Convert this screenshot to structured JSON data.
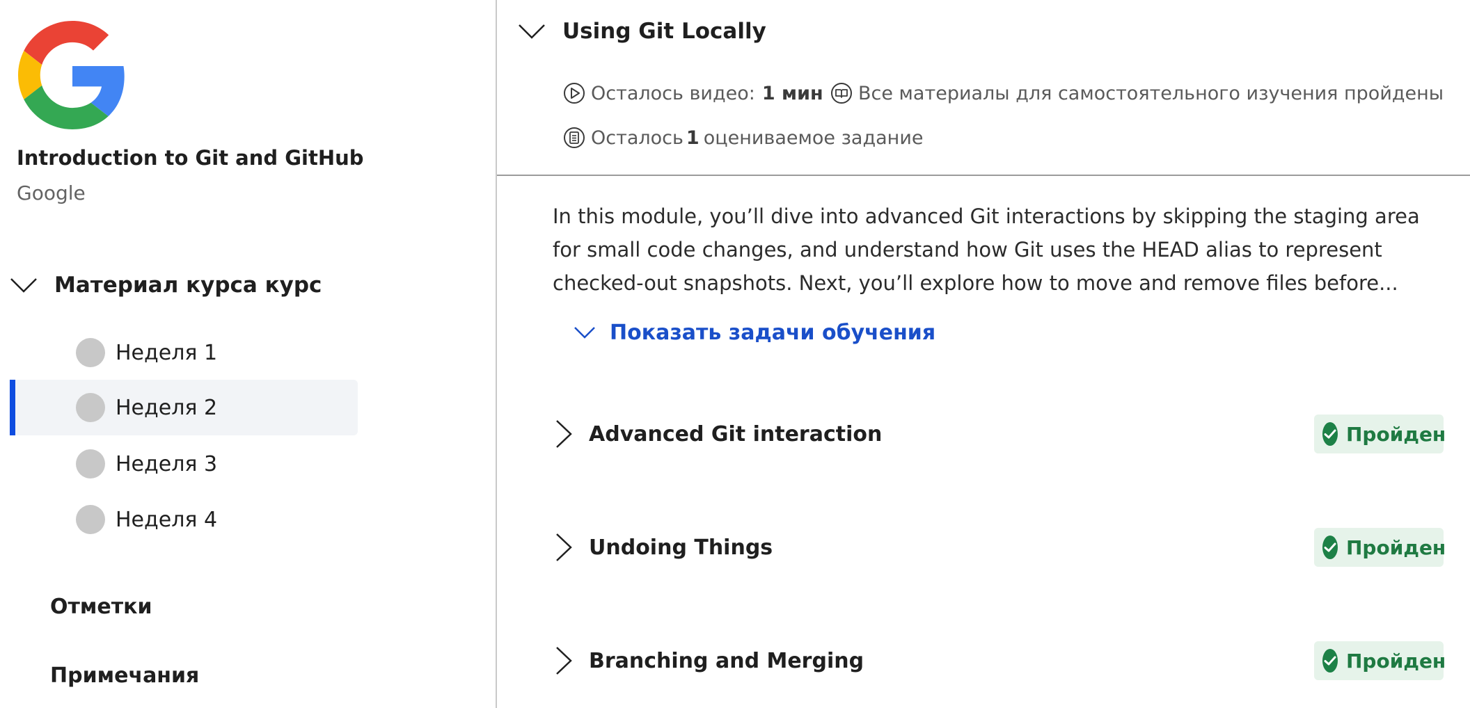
{
  "sidebar": {
    "course_title": "Introduction to Git and GitHub",
    "course_org": "Google",
    "logo_icon": "google-g-logo",
    "section_label": "Материал курса курс",
    "weeks": [
      {
        "label": "Неделя 1",
        "active": false
      },
      {
        "label": "Неделя 2",
        "active": true
      },
      {
        "label": "Неделя 3",
        "active": false
      },
      {
        "label": "Неделя 4",
        "active": false
      }
    ],
    "links": [
      "Отметки",
      "Примечания"
    ]
  },
  "main": {
    "module_title": "Using Git Locally",
    "meta": {
      "video_prefix": "Осталось видео:",
      "video_value": "1 мин",
      "materials_text": "Все материалы для самостоятельного изучения пройдены",
      "assign_prefix": "Осталось",
      "assign_value": "1",
      "assign_suffix": "оцениваемое задание"
    },
    "description": "In this module, you’ll dive into advanced Git interactions by skipping the staging area for small code changes, and understand how Git uses the HEAD alias to represent checked-out snapshots. Next, you’ll explore how to move and remove files before...",
    "show_objectives": "Показать задачи обучения",
    "lessons": [
      {
        "title": "Advanced Git interaction",
        "status": "Пройден"
      },
      {
        "title": "Undoing Things",
        "status": "Пройден"
      },
      {
        "title": "Branching and Merging",
        "status": "Пройден"
      }
    ]
  },
  "colors": {
    "accent_blue": "#1a4fc9",
    "active_bar": "#0f4de0",
    "success_green": "#1d8147",
    "badge_bg": "#e6f3ea"
  }
}
